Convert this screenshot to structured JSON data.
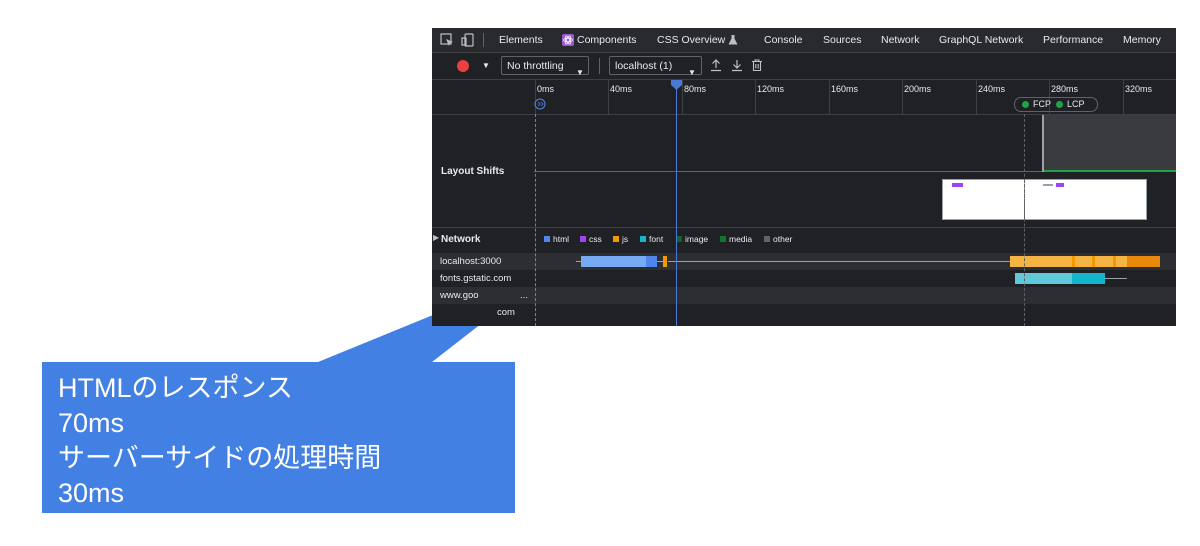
{
  "tabs": [
    "Elements",
    "Components",
    "CSS Overview",
    "Console",
    "Sources",
    "Network",
    "GraphQL Network",
    "Performance",
    "Memory"
  ],
  "icons": {
    "inspect": "inspect-element-icon",
    "device": "device-toggle-icon",
    "components": "react-components-icon",
    "flask": "flask-icon",
    "record": "record-icon",
    "upload": "upload-icon",
    "download": "download-icon",
    "trash": "trash-icon",
    "playhead": "playhead-marker-icon"
  },
  "controls": {
    "throttling": "No throttling",
    "target": "localhost (1)"
  },
  "timeline": {
    "ticks": [
      "0ms",
      "40ms",
      "80ms",
      "120ms",
      "160ms",
      "200ms",
      "240ms",
      "280ms",
      "320ms"
    ],
    "markers": [
      "FCP",
      "LCP"
    ]
  },
  "tracks": {
    "layout_shifts": "Layout Shifts",
    "network": "Network"
  },
  "legend": [
    "html",
    "css",
    "js",
    "font",
    "image",
    "media",
    "other"
  ],
  "network_rows": [
    "localhost:3000",
    "fonts.gstatic.com",
    "www.goo",
    "com"
  ],
  "callout": {
    "line1": "HTMLのレスポンス",
    "line2": "70ms",
    "line3": "サーバーサイドの処理時間",
    "line4": "30ms"
  },
  "colors": {
    "panel_bg": "#202124",
    "record": "#e8413f",
    "accent_blue": "#4380e3",
    "html": "#4f86ec",
    "css": "#a142f4",
    "js": "#f29900",
    "font": "#12b5cb",
    "image": "#0d652d",
    "media": "#137333",
    "other": "#5f6368",
    "marker_green": "#1ea446"
  }
}
